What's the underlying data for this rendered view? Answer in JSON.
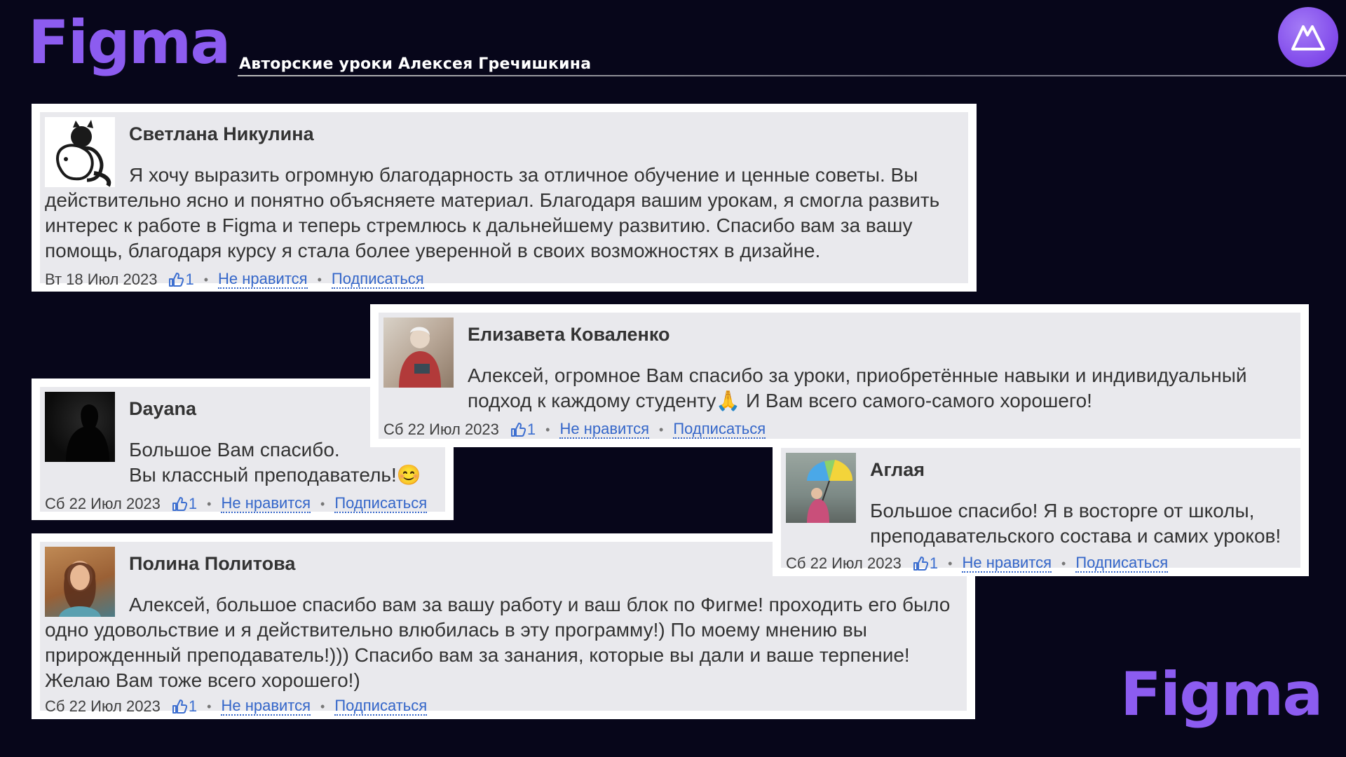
{
  "header": {
    "logo": "Figma",
    "subtitle": "Авторские уроки Алексея Гречишкина"
  },
  "footer": {
    "logo": "Figma"
  },
  "brand_icon": "mountain-logo-icon",
  "colors": {
    "background": "#07061a",
    "accent": "#8c5cf0",
    "link": "#3466c9"
  },
  "labels": {
    "dislike": "Не нравится",
    "subscribe": "Подписаться"
  },
  "reviews": [
    {
      "author": "Светлана Никулина",
      "text_first": "Я хочу выразить огромную благодарность за отличное обучение и ценные советы. Вы действительно ясно и понятно объясняете материал. Благодаря вашим урокам, я смогла развить интерес к работе в Figma и теперь стремлюсь к дальнейшему развитию. Спасибо вам за вашу помощь, благодаря курсу я стала более уверенной в своих возможностях в дизайне.",
      "date": "Вт 18 Июл 2023",
      "likes": "1",
      "avatar": "cat-drawing-avatar"
    },
    {
      "author": "Dayana",
      "line1": "Большое Вам спасибо.",
      "line2": "Вы классный преподаватель!😊",
      "date": "Сб 22 Июл 2023",
      "likes": "1",
      "avatar": "dark-silhouette-avatar"
    },
    {
      "author": "Елизавета Коваленко",
      "line1": "Алексей, огромное Вам спасибо за уроки, приобретённые навыки и индивидуальный",
      "line2": "подход к каждому студенту🙏 И Вам всего самого-самого хорошего!",
      "date": "Сб 22 Июл 2023",
      "likes": "1",
      "avatar": "woman-photo-avatar"
    },
    {
      "author": "Аглая",
      "line1": "Большое спасибо! Я в восторге от школы,",
      "line2": "преподавательского состава и самих уроков!",
      "date": "Сб 22 Июл 2023",
      "likes": "1",
      "avatar": "umbrella-photo-avatar"
    },
    {
      "author": "Полина Политова",
      "text_first": "Алексей, большое спасибо вам за вашу работу и ваш блок по Фигме! проходить его было одно удовольствие и я действительно влюбилась в эту программу!) По моему мнению вы прирожденный преподаватель!))) Спасибо вам за занания, которые вы дали и ваше терпение! Желаю Вам тоже всего хорошего!)",
      "date": "Сб 22 Июл 2023",
      "likes": "1",
      "avatar": "girl-photo-avatar"
    }
  ]
}
